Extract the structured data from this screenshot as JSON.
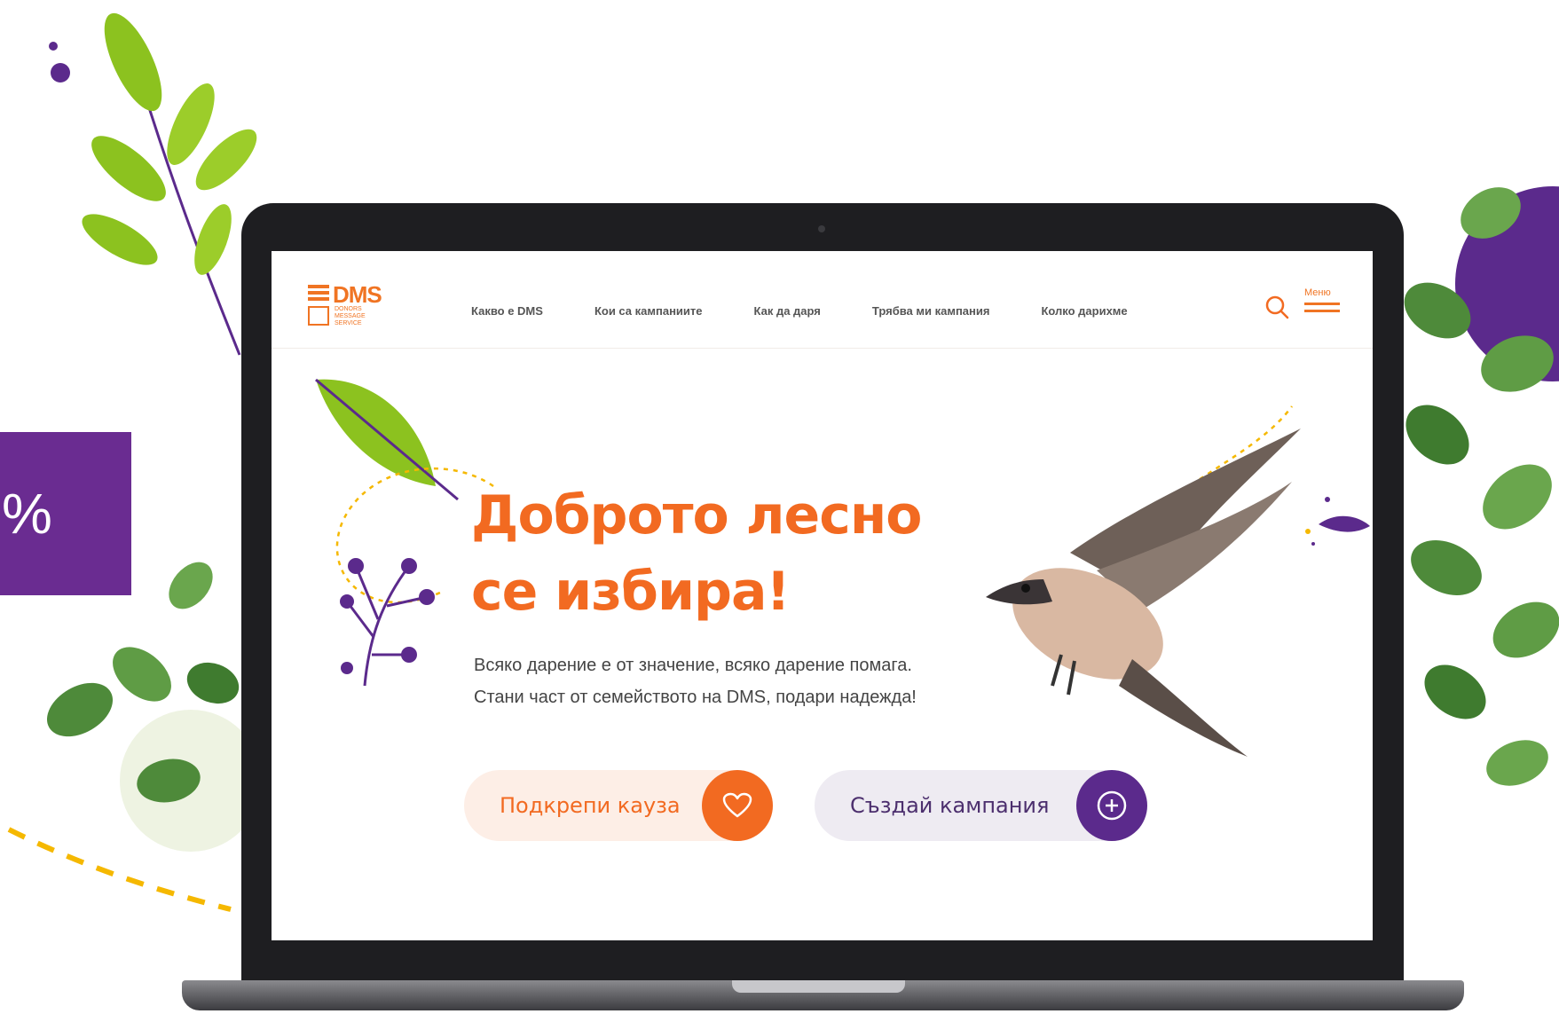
{
  "side_badge": {
    "text": "%"
  },
  "logo": {
    "name": "DMS",
    "subtitle": "DONORS MESSAGE SERVICE"
  },
  "nav": {
    "items": [
      "Какво е DMS",
      "Кои са кампаниите",
      "Как да даря",
      "Трябва ми кампания",
      "Колко дарихме"
    ],
    "menu_label": "Меню"
  },
  "hero": {
    "title_line1": "Доброто лесно",
    "title_line2": "се избира!",
    "subtitle_line1": "Всяко дарение е от значение, всяко дарение помага.",
    "subtitle_line2": "Стани част от семейството на DMS, подари надежда!"
  },
  "cta": {
    "support_label": "Подкрепи кауза",
    "create_label": "Създай кампания"
  },
  "colors": {
    "brand_orange": "#f26a21",
    "brand_purple": "#5b2a8c",
    "leaf_green": "#8cc21f"
  },
  "icons": {
    "search": "search-icon",
    "menu": "hamburger-icon",
    "heart": "heart-icon",
    "plus_circle": "plus-circle-icon"
  }
}
